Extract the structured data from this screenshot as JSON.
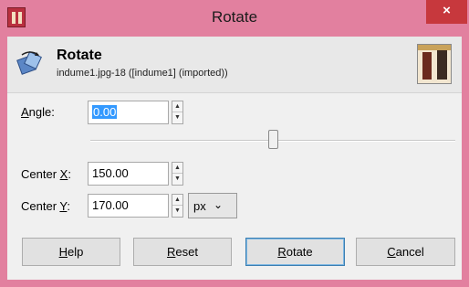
{
  "window": {
    "title": "Rotate",
    "close_glyph": "×",
    "app_icon": "gimp-image-icon"
  },
  "header": {
    "title": "Rotate",
    "subtitle": "indume1.jpg-18 ([indume1] (imported))",
    "icon": "rotate-tool-icon",
    "thumbnail": "image-thumbnail"
  },
  "angle": {
    "label_underlined": "A",
    "label_rest": "ngle:",
    "value": "0.00",
    "slider_fraction": 0.5
  },
  "center_x": {
    "label_prefix": "Center ",
    "label_underlined": "X",
    "label_suffix": ":",
    "value": "150.00"
  },
  "center_y": {
    "label_prefix": "Center ",
    "label_underlined": "Y",
    "label_suffix": ":",
    "value": "170.00"
  },
  "unit": {
    "selected": "px",
    "chevron": "⌄"
  },
  "buttons": {
    "help": {
      "underlined": "H",
      "rest": "elp"
    },
    "reset": {
      "underlined": "R",
      "rest": "eset"
    },
    "rotate": {
      "underlined": "R",
      "rest": "otate"
    },
    "cancel": {
      "underlined": "C",
      "rest": "ancel"
    }
  },
  "colors": {
    "window_frame": "#e2809f",
    "close_button": "#c7383d",
    "selection": "#3399ff"
  }
}
